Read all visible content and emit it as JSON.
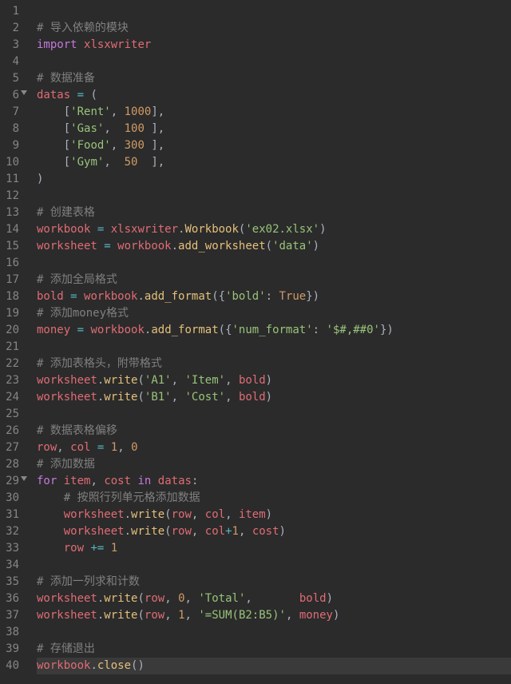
{
  "lines": [
    {
      "n": "1",
      "tokens": []
    },
    {
      "n": "2",
      "tokens": [
        [
          "cmt",
          "# 导入依赖的模块"
        ]
      ]
    },
    {
      "n": "3",
      "tokens": [
        [
          "kw",
          "import"
        ],
        [
          "pl",
          " "
        ],
        [
          "id",
          "xlsxwriter"
        ]
      ]
    },
    {
      "n": "4",
      "tokens": []
    },
    {
      "n": "5",
      "tokens": [
        [
          "cmt",
          "# 数据准备"
        ]
      ]
    },
    {
      "n": "6",
      "fold": true,
      "tokens": [
        [
          "id",
          "datas"
        ],
        [
          "pl",
          " "
        ],
        [
          "op",
          "="
        ],
        [
          "pl",
          " "
        ],
        [
          "pun",
          "("
        ]
      ]
    },
    {
      "n": "7",
      "tokens": [
        [
          "pl",
          "    "
        ],
        [
          "pun",
          "["
        ],
        [
          "str",
          "'Rent'"
        ],
        [
          "pun",
          ","
        ],
        [
          "pl",
          " "
        ],
        [
          "num",
          "1000"
        ],
        [
          "pun",
          "],"
        ]
      ]
    },
    {
      "n": "8",
      "tokens": [
        [
          "pl",
          "    "
        ],
        [
          "pun",
          "["
        ],
        [
          "str",
          "'Gas'"
        ],
        [
          "pun",
          ","
        ],
        [
          "pl",
          "  "
        ],
        [
          "num",
          "100"
        ],
        [
          "pl",
          " "
        ],
        [
          "pun",
          "],"
        ]
      ]
    },
    {
      "n": "9",
      "tokens": [
        [
          "pl",
          "    "
        ],
        [
          "pun",
          "["
        ],
        [
          "str",
          "'Food'"
        ],
        [
          "pun",
          ","
        ],
        [
          "pl",
          " "
        ],
        [
          "num",
          "300"
        ],
        [
          "pl",
          " "
        ],
        [
          "pun",
          "],"
        ]
      ]
    },
    {
      "n": "10",
      "tokens": [
        [
          "pl",
          "    "
        ],
        [
          "pun",
          "["
        ],
        [
          "str",
          "'Gym'"
        ],
        [
          "pun",
          ","
        ],
        [
          "pl",
          "  "
        ],
        [
          "num",
          "50"
        ],
        [
          "pl",
          "  "
        ],
        [
          "pun",
          "],"
        ]
      ]
    },
    {
      "n": "11",
      "tokens": [
        [
          "pun",
          ")"
        ]
      ]
    },
    {
      "n": "12",
      "tokens": []
    },
    {
      "n": "13",
      "tokens": [
        [
          "cmt",
          "# 创建表格"
        ]
      ]
    },
    {
      "n": "14",
      "tokens": [
        [
          "id",
          "workbook"
        ],
        [
          "pl",
          " "
        ],
        [
          "op",
          "="
        ],
        [
          "pl",
          " "
        ],
        [
          "id",
          "xlsxwriter"
        ],
        [
          "pun",
          "."
        ],
        [
          "cls",
          "Workbook"
        ],
        [
          "pun",
          "("
        ],
        [
          "str",
          "'ex02.xlsx'"
        ],
        [
          "pun",
          ")"
        ]
      ]
    },
    {
      "n": "15",
      "tokens": [
        [
          "id",
          "worksheet"
        ],
        [
          "pl",
          " "
        ],
        [
          "op",
          "="
        ],
        [
          "pl",
          " "
        ],
        [
          "id",
          "workbook"
        ],
        [
          "pun",
          "."
        ],
        [
          "fn",
          "add_worksheet"
        ],
        [
          "pun",
          "("
        ],
        [
          "str",
          "'data'"
        ],
        [
          "pun",
          ")"
        ]
      ]
    },
    {
      "n": "16",
      "tokens": []
    },
    {
      "n": "17",
      "tokens": [
        [
          "cmt",
          "# 添加全局格式"
        ]
      ]
    },
    {
      "n": "18",
      "tokens": [
        [
          "id",
          "bold"
        ],
        [
          "pl",
          " "
        ],
        [
          "op",
          "="
        ],
        [
          "pl",
          " "
        ],
        [
          "id",
          "workbook"
        ],
        [
          "pun",
          "."
        ],
        [
          "fn",
          "add_format"
        ],
        [
          "pun",
          "({"
        ],
        [
          "str",
          "'bold'"
        ],
        [
          "pun",
          ":"
        ],
        [
          "pl",
          " "
        ],
        [
          "num",
          "True"
        ],
        [
          "pun",
          "})"
        ]
      ]
    },
    {
      "n": "19",
      "tokens": [
        [
          "cmt",
          "# 添加money格式"
        ]
      ]
    },
    {
      "n": "20",
      "tokens": [
        [
          "id",
          "money"
        ],
        [
          "pl",
          " "
        ],
        [
          "op",
          "="
        ],
        [
          "pl",
          " "
        ],
        [
          "id",
          "workbook"
        ],
        [
          "pun",
          "."
        ],
        [
          "fn",
          "add_format"
        ],
        [
          "pun",
          "({"
        ],
        [
          "str",
          "'num_format'"
        ],
        [
          "pun",
          ":"
        ],
        [
          "pl",
          " "
        ],
        [
          "str",
          "'$#,##0'"
        ],
        [
          "pun",
          "})"
        ]
      ]
    },
    {
      "n": "21",
      "tokens": []
    },
    {
      "n": "22",
      "tokens": [
        [
          "cmt",
          "# 添加表格头，附带格式"
        ]
      ]
    },
    {
      "n": "23",
      "tokens": [
        [
          "id",
          "worksheet"
        ],
        [
          "pun",
          "."
        ],
        [
          "fn",
          "write"
        ],
        [
          "pun",
          "("
        ],
        [
          "str",
          "'A1'"
        ],
        [
          "pun",
          ","
        ],
        [
          "pl",
          " "
        ],
        [
          "str",
          "'Item'"
        ],
        [
          "pun",
          ","
        ],
        [
          "pl",
          " "
        ],
        [
          "id",
          "bold"
        ],
        [
          "pun",
          ")"
        ]
      ]
    },
    {
      "n": "24",
      "tokens": [
        [
          "id",
          "worksheet"
        ],
        [
          "pun",
          "."
        ],
        [
          "fn",
          "write"
        ],
        [
          "pun",
          "("
        ],
        [
          "str",
          "'B1'"
        ],
        [
          "pun",
          ","
        ],
        [
          "pl",
          " "
        ],
        [
          "str",
          "'Cost'"
        ],
        [
          "pun",
          ","
        ],
        [
          "pl",
          " "
        ],
        [
          "id",
          "bold"
        ],
        [
          "pun",
          ")"
        ]
      ]
    },
    {
      "n": "25",
      "tokens": []
    },
    {
      "n": "26",
      "tokens": [
        [
          "cmt",
          "# 数据表格偏移"
        ]
      ]
    },
    {
      "n": "27",
      "tokens": [
        [
          "id",
          "row"
        ],
        [
          "pun",
          ","
        ],
        [
          "pl",
          " "
        ],
        [
          "id",
          "col"
        ],
        [
          "pl",
          " "
        ],
        [
          "op",
          "="
        ],
        [
          "pl",
          " "
        ],
        [
          "num",
          "1"
        ],
        [
          "pun",
          ","
        ],
        [
          "pl",
          " "
        ],
        [
          "num",
          "0"
        ]
      ]
    },
    {
      "n": "28",
      "tokens": [
        [
          "cmt",
          "# 添加数据"
        ]
      ]
    },
    {
      "n": "29",
      "fold": true,
      "tokens": [
        [
          "kw",
          "for"
        ],
        [
          "pl",
          " "
        ],
        [
          "id",
          "item"
        ],
        [
          "pun",
          ","
        ],
        [
          "pl",
          " "
        ],
        [
          "id",
          "cost"
        ],
        [
          "pl",
          " "
        ],
        [
          "kw",
          "in"
        ],
        [
          "pl",
          " "
        ],
        [
          "id",
          "datas"
        ],
        [
          "pun",
          ":"
        ]
      ]
    },
    {
      "n": "30",
      "tokens": [
        [
          "pl",
          "    "
        ],
        [
          "cmt",
          "# 按照行列单元格添加数据"
        ]
      ]
    },
    {
      "n": "31",
      "tokens": [
        [
          "pl",
          "    "
        ],
        [
          "id",
          "worksheet"
        ],
        [
          "pun",
          "."
        ],
        [
          "fn",
          "write"
        ],
        [
          "pun",
          "("
        ],
        [
          "id",
          "row"
        ],
        [
          "pun",
          ","
        ],
        [
          "pl",
          " "
        ],
        [
          "id",
          "col"
        ],
        [
          "pun",
          ","
        ],
        [
          "pl",
          " "
        ],
        [
          "id",
          "item"
        ],
        [
          "pun",
          ")"
        ]
      ]
    },
    {
      "n": "32",
      "tokens": [
        [
          "pl",
          "    "
        ],
        [
          "id",
          "worksheet"
        ],
        [
          "pun",
          "."
        ],
        [
          "fn",
          "write"
        ],
        [
          "pun",
          "("
        ],
        [
          "id",
          "row"
        ],
        [
          "pun",
          ","
        ],
        [
          "pl",
          " "
        ],
        [
          "id",
          "col"
        ],
        [
          "op",
          "+"
        ],
        [
          "num",
          "1"
        ],
        [
          "pun",
          ","
        ],
        [
          "pl",
          " "
        ],
        [
          "id",
          "cost"
        ],
        [
          "pun",
          ")"
        ]
      ]
    },
    {
      "n": "33",
      "tokens": [
        [
          "pl",
          "    "
        ],
        [
          "id",
          "row"
        ],
        [
          "pl",
          " "
        ],
        [
          "op",
          "+="
        ],
        [
          "pl",
          " "
        ],
        [
          "num",
          "1"
        ]
      ]
    },
    {
      "n": "34",
      "tokens": []
    },
    {
      "n": "35",
      "tokens": [
        [
          "cmt",
          "# 添加一列求和计数"
        ]
      ]
    },
    {
      "n": "36",
      "tokens": [
        [
          "id",
          "worksheet"
        ],
        [
          "pun",
          "."
        ],
        [
          "fn",
          "write"
        ],
        [
          "pun",
          "("
        ],
        [
          "id",
          "row"
        ],
        [
          "pun",
          ","
        ],
        [
          "pl",
          " "
        ],
        [
          "num",
          "0"
        ],
        [
          "pun",
          ","
        ],
        [
          "pl",
          " "
        ],
        [
          "str",
          "'Total'"
        ],
        [
          "pun",
          ","
        ],
        [
          "pl",
          "       "
        ],
        [
          "id",
          "bold"
        ],
        [
          "pun",
          ")"
        ]
      ]
    },
    {
      "n": "37",
      "tokens": [
        [
          "id",
          "worksheet"
        ],
        [
          "pun",
          "."
        ],
        [
          "fn",
          "write"
        ],
        [
          "pun",
          "("
        ],
        [
          "id",
          "row"
        ],
        [
          "pun",
          ","
        ],
        [
          "pl",
          " "
        ],
        [
          "num",
          "1"
        ],
        [
          "pun",
          ","
        ],
        [
          "pl",
          " "
        ],
        [
          "str",
          "'=SUM(B2:B5)'"
        ],
        [
          "pun",
          ","
        ],
        [
          "pl",
          " "
        ],
        [
          "id",
          "money"
        ],
        [
          "pun",
          ")"
        ]
      ]
    },
    {
      "n": "38",
      "tokens": []
    },
    {
      "n": "39",
      "tokens": [
        [
          "cmt",
          "# 存储退出"
        ]
      ]
    },
    {
      "n": "40",
      "hl": true,
      "tokens": [
        [
          "id",
          "workbook"
        ],
        [
          "pun",
          "."
        ],
        [
          "fn",
          "close"
        ],
        [
          "pun",
          "()"
        ]
      ]
    }
  ]
}
